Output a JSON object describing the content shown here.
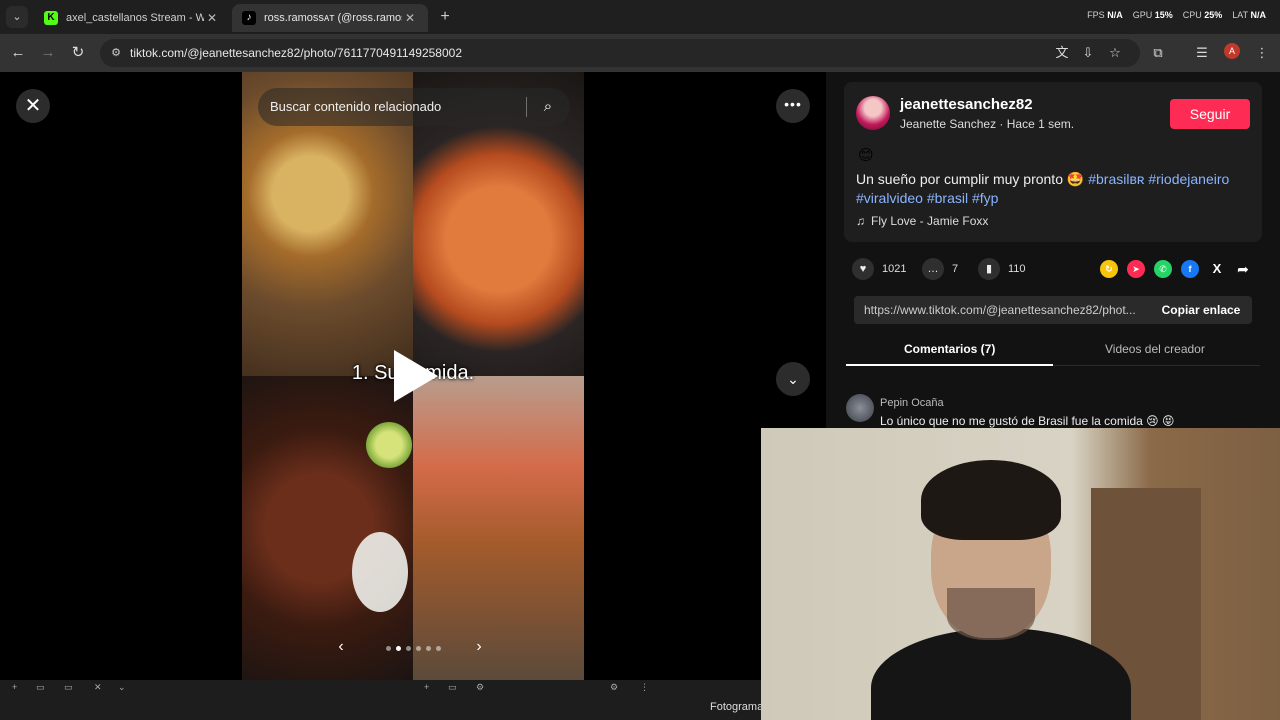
{
  "browser": {
    "tabs": [
      {
        "title": "axel_castellanos Stream - Watch",
        "favicon": "K",
        "favicon_color": "#53fc18"
      },
      {
        "title": "ross.ramossᴀᴛ (@ross.ramoss) |",
        "favicon": "♪",
        "favicon_color": "#ffffff"
      }
    ],
    "url": "tiktok.com/@jeanettesanchez82/photo/7611770491149258002",
    "perf": {
      "fps_label": "FPS",
      "fps": "N/A",
      "gpu_label": "GPU",
      "gpu": "15%",
      "cpu_label": "CPU",
      "cpu": "25%",
      "lat_label": "LAT",
      "lat": "N/A"
    },
    "profile_initial": "A"
  },
  "viewer": {
    "search_placeholder": "Buscar contenido relacionado",
    "caption": "1. Su comida.",
    "dots_total": 6,
    "dots_active": 2
  },
  "post": {
    "username": "jeanettesanchez82",
    "subtitle": "Jeanette Sanchez · Hace 1 sem.",
    "follow_label": "Seguir",
    "emoji": "😊",
    "desc_text": "Un sueño por cumplir muy pronto 🤩",
    "hashtags": [
      "#brasilʙʀ",
      "#riodejaneiro",
      "#viralvideo",
      "#brasil",
      "#fyp"
    ],
    "music": "Fly Love - Jamie Foxx",
    "likes": "1021",
    "comments": "7",
    "saves": "110",
    "link_url": "https://www.tiktok.com/@jeanettesanchez82/phot...",
    "copy_label": "Copiar enlace",
    "tab_comments": "Comentarios (7)",
    "tab_videos": "Videos del creador",
    "comment_user": "Pepin Ocaña",
    "comment_text": "Lo único que no me gustó de Brasil fue la comida 😢 😝"
  },
  "bottom": {
    "fotograma": "Fotograma"
  },
  "colors": {
    "accent": "#fe2c55",
    "hashtag": "#8ab4ff"
  }
}
